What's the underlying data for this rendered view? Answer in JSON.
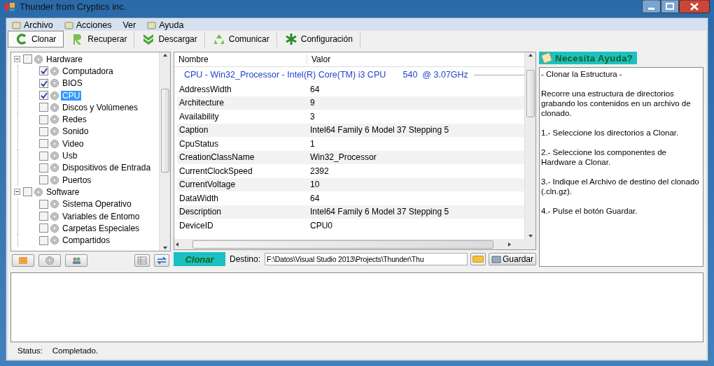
{
  "window": {
    "title": "Thunder from Cryptics inc."
  },
  "menu": [
    {
      "label": "Archivo",
      "has_icon": true
    },
    {
      "label": "Acciones",
      "has_icon": true
    },
    {
      "label": "Ver",
      "has_icon": false
    },
    {
      "label": "Ayuda",
      "has_icon": true
    }
  ],
  "toolbar": [
    {
      "label": "Clonar",
      "selected": true,
      "kind": "clone"
    },
    {
      "label": "Recuperar",
      "selected": false,
      "kind": "recover"
    },
    {
      "label": "Descargar",
      "selected": false,
      "kind": "download"
    },
    {
      "label": "Comunicar",
      "selected": false,
      "kind": "share"
    },
    {
      "label": "Configuración",
      "selected": false,
      "kind": "config"
    }
  ],
  "tree": [
    {
      "label": "Hardware",
      "expanded": true,
      "checked": false,
      "selected": false,
      "children": [
        {
          "label": "Computadora",
          "checked": true,
          "selected": false
        },
        {
          "label": "BIOS",
          "checked": true,
          "selected": false
        },
        {
          "label": "CPU",
          "checked": true,
          "selected": true
        },
        {
          "label": "Discos y Volúmenes",
          "checked": false,
          "selected": false
        },
        {
          "label": "Redes",
          "checked": false,
          "selected": false
        },
        {
          "label": "Sonido",
          "checked": false,
          "selected": false
        },
        {
          "label": "Video",
          "checked": false,
          "selected": false
        },
        {
          "label": "Usb",
          "checked": false,
          "selected": false
        },
        {
          "label": "Dispositivos de Entrada",
          "checked": false,
          "selected": false
        },
        {
          "label": "Puertos",
          "checked": false,
          "selected": false
        }
      ]
    },
    {
      "label": "Software",
      "expanded": true,
      "checked": false,
      "selected": false,
      "children": [
        {
          "label": "Sistema Operativo",
          "checked": false,
          "selected": false
        },
        {
          "label": "Variables de Entomo",
          "checked": false,
          "selected": false
        },
        {
          "label": "Carpetas Especiales",
          "checked": false,
          "selected": false
        },
        {
          "label": "Compartidos",
          "checked": false,
          "selected": false
        }
      ]
    }
  ],
  "grid": {
    "columns": [
      "Nombre",
      "Valor"
    ],
    "group": "CPU - Win32_Processor - Intel(R) Core(TM) i3 CPU       540  @ 3.07GHz",
    "rows": [
      [
        "AddressWidth",
        "64"
      ],
      [
        "Architecture",
        "9"
      ],
      [
        "Availability",
        "3"
      ],
      [
        "Caption",
        "Intel64 Family 6 Model 37 Stepping 5"
      ],
      [
        "CpuStatus",
        "1"
      ],
      [
        "CreationClassName",
        "Win32_Processor"
      ],
      [
        "CurrentClockSpeed",
        "2392"
      ],
      [
        "CurrentVoltage",
        "10"
      ],
      [
        "DataWidth",
        "64"
      ],
      [
        "Description",
        "Intel64 Family 6 Model 37 Stepping 5"
      ],
      [
        "DeviceID",
        "CPU0"
      ]
    ]
  },
  "action_bar": {
    "mode_label": "Clonar",
    "destination_label": "Destino:",
    "destination_value": "F:\\Datos\\Visual Studio 2013\\Projects\\Thunder\\Thu",
    "save_button": "Guardar"
  },
  "help": {
    "title": "Necesita Ayuda?",
    "paragraphs": [
      "- Clonar la Estructura -",
      "Recorre una estructura de directorios grabando los contenidos en un archivo de clonado.",
      "1.- Seleccione los directorios a Clonar.",
      "2.- Seleccione los componentes de Hardware a Clonar.",
      "3.- Indique el Archivo de destino del clonado (.cln.gz).",
      "4.- Pulse el botón Guardar."
    ]
  },
  "status_bar": {
    "label": "Status:",
    "value": "Completado."
  }
}
